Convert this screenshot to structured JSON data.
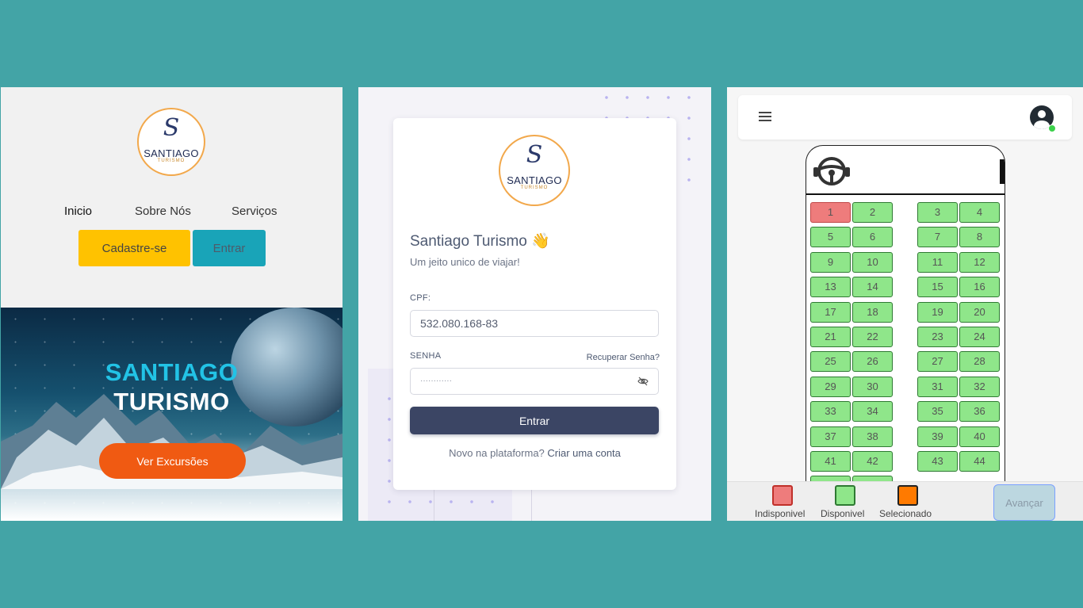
{
  "home": {
    "logo": {
      "monogram": "S",
      "name": "SANTIAGO",
      "tagline": "TURISMO"
    },
    "nav": [
      "Inicio",
      "Sobre Nós",
      "Serviços"
    ],
    "signup_label": "Cadastre-se",
    "login_label": "Entrar",
    "hero": {
      "line1": "SANTIAGO",
      "line2": "TURISMO",
      "cta": "Ver Excursões"
    }
  },
  "login": {
    "logo": {
      "monogram": "S",
      "name": "SANTIAGO",
      "tagline": "TURISMO"
    },
    "title": "Santiago Turismo 👋",
    "subtitle": "Um jeito unico de viajar!",
    "cpf_label": "CPF:",
    "cpf_value": "532.080.168-83",
    "password_label": "SENHA",
    "forgot_label": "Recuperar Senha?",
    "password_value": "············",
    "submit_label": "Entrar",
    "signup_prompt": "Novo na plataforma?",
    "signup_link": "Criar uma conta"
  },
  "seats": {
    "rows": [
      [
        "1",
        "2",
        "3",
        "4"
      ],
      [
        "5",
        "6",
        "7",
        "8"
      ],
      [
        "9",
        "10",
        "11",
        "12"
      ],
      [
        "13",
        "14",
        "15",
        "16"
      ],
      [
        "17",
        "18",
        "19",
        "20"
      ],
      [
        "21",
        "22",
        "23",
        "24"
      ],
      [
        "25",
        "26",
        "27",
        "28"
      ],
      [
        "29",
        "30",
        "31",
        "32"
      ],
      [
        "33",
        "34",
        "35",
        "36"
      ],
      [
        "37",
        "38",
        "39",
        "40"
      ],
      [
        "41",
        "42",
        "43",
        "44"
      ]
    ],
    "unavailable": [
      "1"
    ],
    "legend": {
      "unavailable": "Indisponivel",
      "available": "Disponivel",
      "selected": "Selecionado"
    },
    "next_label": "Avançar",
    "colors": {
      "unavailable": "#ee7c7c",
      "available": "#8fe68a",
      "selected": "#ff7a00"
    }
  }
}
